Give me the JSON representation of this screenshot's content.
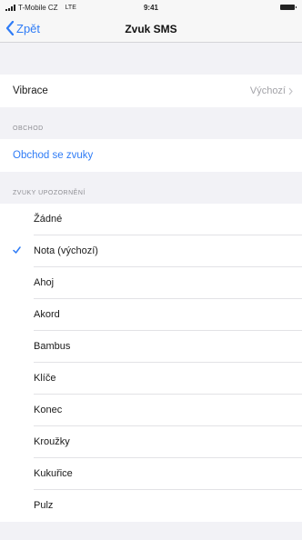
{
  "status_bar": {
    "carrier": "T-Mobile CZ",
    "network": "LTE",
    "time": "9:41"
  },
  "nav": {
    "back_label": "Zpět",
    "title": "Zvuk SMS"
  },
  "vibration": {
    "label": "Vibrace",
    "value": "Výchozí"
  },
  "store_section": {
    "header": "OBCHOD",
    "link": "Obchod se zvuky"
  },
  "alert_section": {
    "header": "ZVUKY UPOZORNĚNÍ",
    "items": [
      {
        "label": "Žádné",
        "selected": false
      },
      {
        "label": "Nota (výchozí)",
        "selected": true
      },
      {
        "label": "Ahoj",
        "selected": false
      },
      {
        "label": "Akord",
        "selected": false
      },
      {
        "label": "Bambus",
        "selected": false
      },
      {
        "label": "Klíče",
        "selected": false
      },
      {
        "label": "Konec",
        "selected": false
      },
      {
        "label": "Kroužky",
        "selected": false
      },
      {
        "label": "Kukuřice",
        "selected": false
      },
      {
        "label": "Pulz",
        "selected": false
      }
    ]
  },
  "colors": {
    "accent": "#2f7cf6",
    "background": "#f2f2f6",
    "secondary_text": "#8e8e93"
  }
}
